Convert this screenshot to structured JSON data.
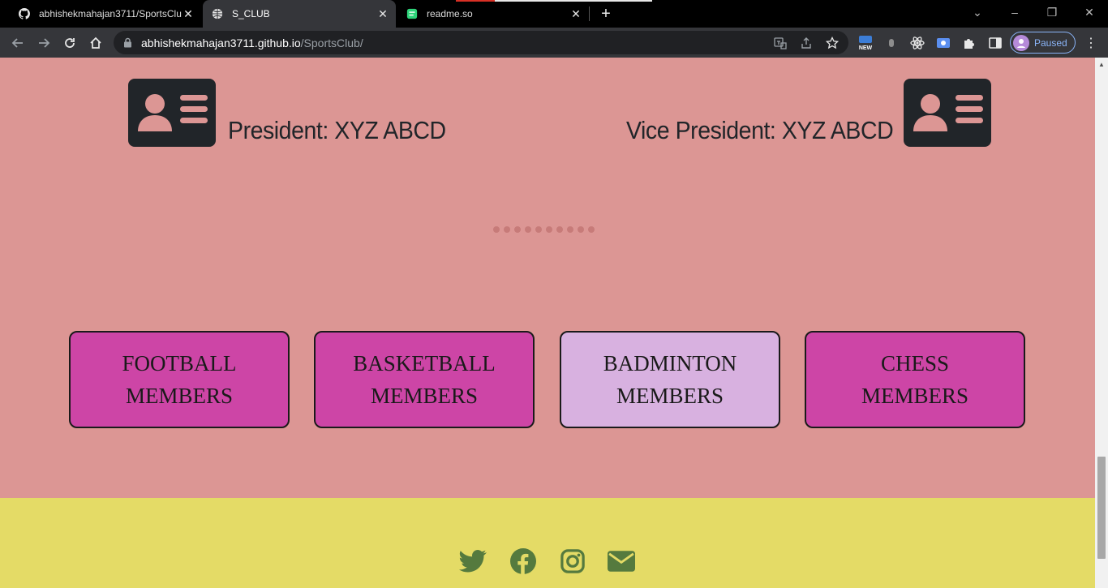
{
  "browser": {
    "tabs": [
      {
        "title": "abhishekmahajan3711/SportsClub",
        "icon": "github-icon"
      },
      {
        "title": "S_CLUB",
        "icon": "globe-icon"
      },
      {
        "title": "readme.so",
        "icon": "readme-icon"
      }
    ],
    "url_host": "abhishekmahajan3711.github.io",
    "url_path": "/SportsClub/",
    "profile_label": "Paused",
    "ext_new_badge": "NEW"
  },
  "officers": {
    "president": "President: XYZ ABCD",
    "vice_president": "Vice President: XYZ ABCD"
  },
  "carousel": {
    "dot_count": 10
  },
  "teams": [
    {
      "line1": "FOOTBALL",
      "line2": "MEMBERS",
      "state": "default"
    },
    {
      "line1": "BASKETBALL",
      "line2": "MEMBERS",
      "state": "default"
    },
    {
      "line1": "BADMINTON",
      "line2": "MEMBERS",
      "state": "selected"
    },
    {
      "line1": "CHESS",
      "line2": "MEMBERS",
      "state": "default"
    }
  ],
  "footer": {
    "social_icons": [
      "twitter-icon",
      "facebook-icon",
      "instagram-icon",
      "email-icon"
    ]
  },
  "colors": {
    "section_bg": "#dc9694",
    "footer_bg": "#e4db66",
    "button_bg": "#cd45a6",
    "button_selected_bg": "#d8b1e0",
    "icon_dark": "#212529",
    "social_icon": "#557a3e"
  }
}
